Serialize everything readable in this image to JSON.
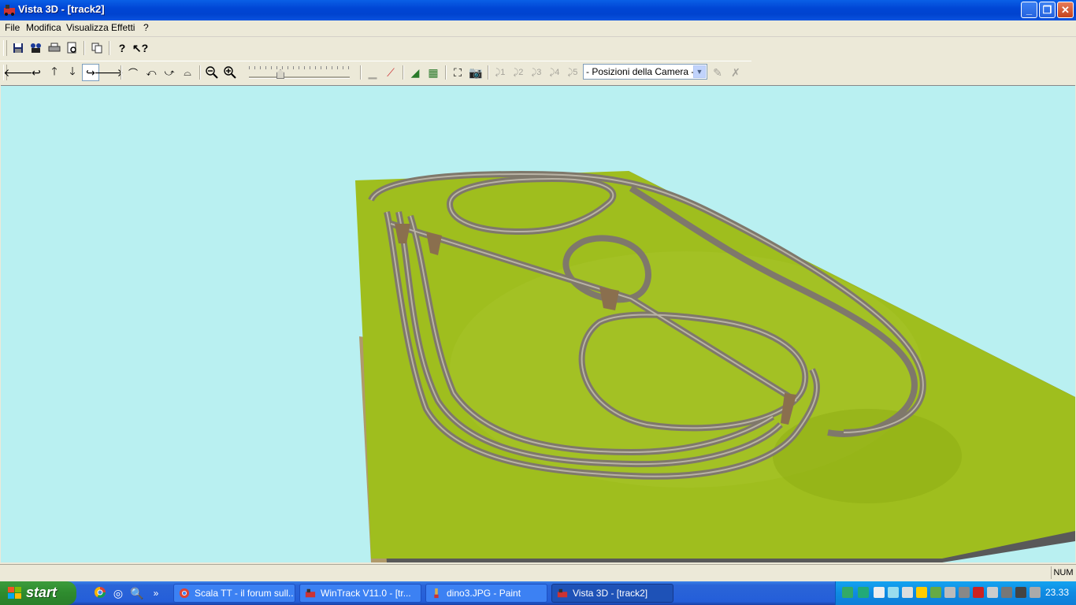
{
  "window": {
    "title": "Vista 3D - [track2]",
    "buttons": {
      "minimize": "_",
      "restore": "❐",
      "close": "✕"
    }
  },
  "menu": {
    "items": [
      "File",
      "Modifica",
      "Visualizza",
      "Effetti",
      "?"
    ]
  },
  "toolbar1": {
    "icons": [
      "save-icon",
      "camera-film-icon",
      "print-icon",
      "print-preview-icon",
      "copy-icon",
      "help-icon",
      "context-help-icon"
    ]
  },
  "toolbar2": {
    "icons": [
      "arrow-left-icon",
      "turn-left-icon",
      "arrow-up-icon",
      "arrow-down-icon",
      "turn-right-icon",
      "arrow-right-icon",
      "view-tilt-up-icon",
      "view-rotate-left-icon",
      "view-rotate-right-icon",
      "view-tilt-down-icon",
      "zoom-out-icon",
      "zoom-in-icon"
    ],
    "camera_positions": {
      "labels": [
        "1",
        "2",
        "3",
        "4",
        "5"
      ]
    },
    "camera_select": {
      "value": "- Posizioni della Camera -"
    },
    "zoom_slider_level": 0.3
  },
  "status": {
    "num": "NUM"
  },
  "taskbar": {
    "start_label": "start",
    "tasks": [
      {
        "label": "Scala TT - il forum sull...",
        "icon": "chrome-icon"
      },
      {
        "label": "WinTrack  V11.0 - [tr...",
        "icon": "wintrack-icon"
      },
      {
        "label": "dino3.JPG - Paint",
        "icon": "paint-icon"
      },
      {
        "label": "Vista 3D - [track2]",
        "icon": "wintrack-icon"
      }
    ],
    "clock": "23.33",
    "quicklaunch_more": "»"
  },
  "colors": {
    "sky": "#b9f0f1",
    "grass": "#9fbe1e",
    "track": "#8a8477",
    "base_side": "#555555",
    "titlebar": "#0046d5"
  }
}
